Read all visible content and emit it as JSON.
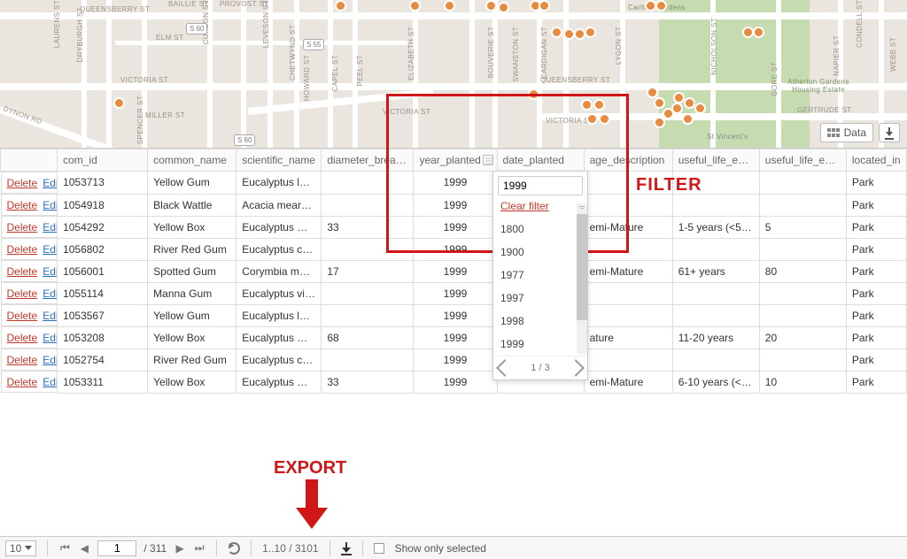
{
  "map": {
    "data_button": "Data",
    "streets": {
      "victoria": "VICTORIA ST",
      "queensberry": "QUEENSBERRY ST",
      "gertrude": "GERTRUDE ST",
      "elm": "ELM ST",
      "miller": "MILLER ST",
      "dynon": "DYNON RD",
      "spencer": "SPENCER ST",
      "dryburgh": "DRYBURGH ST",
      "laurens": "LAURENS ST",
      "chetwynd": "CHETWYND ST",
      "howard": "HOWARD ST",
      "capel": "CAPEL ST",
      "peel": "PEEL ST",
      "elizabeth": "ELIZABETH ST",
      "swanston": "SWANSTON ST",
      "lygon": "LYGON ST",
      "nicholson": "NICHOLSON ST",
      "bouverie": "BOUVERIE ST",
      "cardigan": "CARDIGAN ST",
      "condell": "CONDELL ST",
      "webb": "WEBB ST",
      "napier": "NAPIER ST",
      "gore": "GORE ST",
      "baillie": "BAILLIE ST",
      "provost": "PROVOST ST",
      "curzon": "CURZON ST",
      "leveson": "LEVESON ST",
      "carlton_gardens": "Carlton Gardens",
      "atherton": "Atherton Gardens Housing Estate",
      "stvincents": "St Vincent's"
    },
    "shields": {
      "s55": "S 55",
      "s60": "S 60"
    }
  },
  "annotations": {
    "filter": "FILTER",
    "export": "EXPORT"
  },
  "table": {
    "headers": {
      "com_id": "com_id",
      "common_name": "common_name",
      "scientific_name": "scientific_name",
      "diameter": "diameter_breast_",
      "year_planted": "year_planted",
      "date_planted": "date_planted",
      "age_desc": "age_description",
      "ule1": "useful_life_expec",
      "ule2": "useful_life_expec",
      "located_in": "located_in"
    },
    "actions": {
      "delete": "Delete",
      "edit": "Edit"
    },
    "rows": [
      {
        "id": "1053713",
        "cn": "Yellow Gum",
        "sn": "Eucalyptus leu...",
        "db": "",
        "yp": "1999",
        "dp": "",
        "ad": "",
        "u1": "",
        "u2": "",
        "li": "Park"
      },
      {
        "id": "1054918",
        "cn": "Black Wattle",
        "sn": "Acacia mearnsii",
        "db": "",
        "yp": "1999",
        "dp": "",
        "ad": "",
        "u1": "",
        "u2": "",
        "li": "Park"
      },
      {
        "id": "1054292",
        "cn": "Yellow Box",
        "sn": "Eucalyptus mel...",
        "db": "33",
        "yp": "1999",
        "dp": "",
        "ad": "emi-Mature",
        "u1": "1-5 years (<50...",
        "u2": "5",
        "li": "Park"
      },
      {
        "id": "1056802",
        "cn": "River Red Gum",
        "sn": "Eucalyptus ca...",
        "db": "",
        "yp": "1999",
        "dp": "",
        "ad": "",
        "u1": "",
        "u2": "",
        "li": "Park"
      },
      {
        "id": "1056001",
        "cn": "Spotted Gum",
        "sn": "Corymbia mac...",
        "db": "17",
        "yp": "1999",
        "dp": "",
        "ad": "emi-Mature",
        "u1": "61+ years",
        "u2": "80",
        "li": "Park"
      },
      {
        "id": "1055114",
        "cn": "Manna Gum",
        "sn": "Eucalyptus vim...",
        "db": "",
        "yp": "1999",
        "dp": "",
        "ad": "",
        "u1": "",
        "u2": "",
        "li": "Park"
      },
      {
        "id": "1053567",
        "cn": "Yellow Gum",
        "sn": "Eucalyptus leu...",
        "db": "",
        "yp": "1999",
        "dp": "",
        "ad": "",
        "u1": "",
        "u2": "",
        "li": "Park"
      },
      {
        "id": "1053208",
        "cn": "Yellow Box",
        "sn": "Eucalyptus mel...",
        "db": "68",
        "yp": "1999",
        "dp": "",
        "ad": "ature",
        "u1": "11-20 years",
        "u2": "20",
        "li": "Park"
      },
      {
        "id": "1052754",
        "cn": "River Red Gum",
        "sn": "Eucalyptus ca...",
        "db": "",
        "yp": "1999",
        "dp": "",
        "ad": "",
        "u1": "",
        "u2": "",
        "li": "Park"
      },
      {
        "id": "1053311",
        "cn": "Yellow Box",
        "sn": "Eucalyptus mel...",
        "db": "33",
        "yp": "1999",
        "dp": "",
        "ad": "emi-Mature",
        "u1": "6-10 years (<5...",
        "u2": "10",
        "li": "Park"
      }
    ]
  },
  "filter": {
    "value": "1999",
    "clear": "Clear filter",
    "options": [
      "1800",
      "1900",
      "1977",
      "1997",
      "1998",
      "1999"
    ],
    "pager": "1 / 3"
  },
  "footer": {
    "page_size": "10",
    "page_num": "1",
    "total_pages": "/ 311",
    "range": "1..10 / 3101",
    "show_selected": "Show only selected"
  }
}
